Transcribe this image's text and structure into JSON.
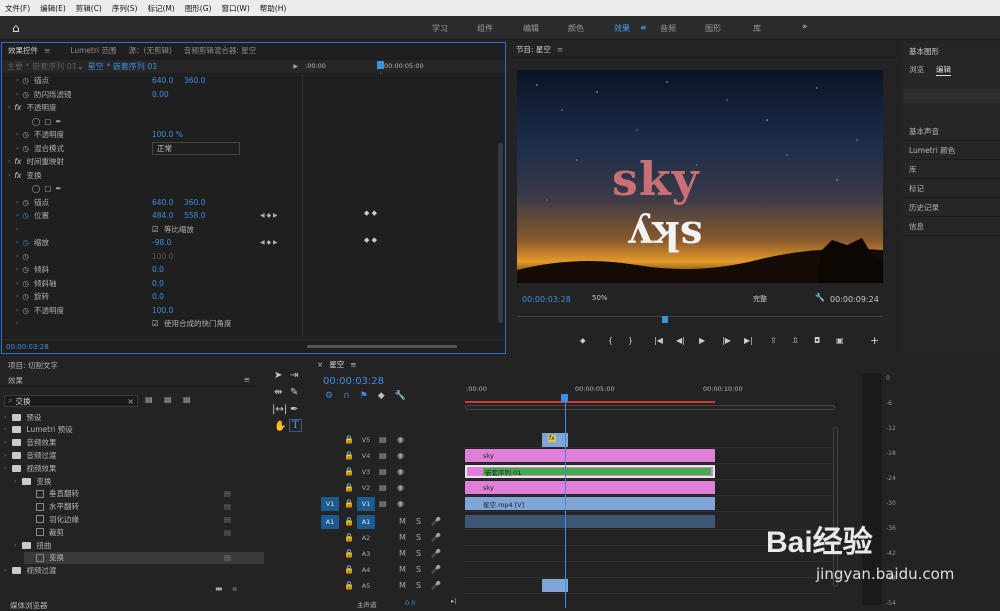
{
  "menu": [
    "文件(F)",
    "编辑(E)",
    "剪辑(C)",
    "序列(S)",
    "标记(M)",
    "图形(G)",
    "窗口(W)",
    "帮助(H)"
  ],
  "workspaces": {
    "items": [
      "学习",
      "组件",
      "编辑",
      "颜色",
      "效果",
      "音频",
      "图形",
      "库"
    ],
    "active": "效果",
    "more": "»"
  },
  "fx_panel": {
    "tabs": [
      "效果控件",
      "Lumetri 范围",
      "源：(无剪辑)",
      "音频剪辑混合器: 星空"
    ],
    "source_label": "主要 * 嵌套序列 01",
    "sequence_label": "星空 * 嵌套序列 01",
    "ruler_times": [
      ":00:00",
      "00:00:05:00"
    ],
    "rows": [
      {
        "label": "锚点",
        "v1": "640.0",
        "v2": "360.0",
        "indent": 2
      },
      {
        "label": "防闪烁滤镜",
        "v1": "0.00",
        "v2": "",
        "indent": 2
      },
      {
        "label": "不透明度",
        "v1": "",
        "v2": "",
        "indent": 1,
        "fx": true
      },
      {
        "label": "",
        "v1": "",
        "v2": "",
        "indent": 2,
        "shapes": true
      },
      {
        "label": "不透明度",
        "v1": "100.0 %",
        "v2": "",
        "indent": 2
      },
      {
        "label": "混合模式",
        "v1": "正常",
        "v2": "",
        "indent": 2,
        "dropdown": true
      },
      {
        "label": "时间重映射",
        "v1": "",
        "v2": "",
        "indent": 1,
        "fx": true
      },
      {
        "label": "变换",
        "v1": "",
        "v2": "",
        "indent": 1,
        "fx": true
      },
      {
        "label": "",
        "v1": "",
        "v2": "",
        "indent": 2,
        "shapes": true
      },
      {
        "label": "锚点",
        "v1": "640.0",
        "v2": "360.0",
        "indent": 2
      },
      {
        "label": "位置",
        "v1": "484.0",
        "v2": "558.0",
        "indent": 2,
        "kf": true
      },
      {
        "label": "等比缩放",
        "v1": "",
        "v2": "",
        "indent": 2,
        "check": true
      },
      {
        "label": "缩放",
        "v1": "-98.0",
        "v2": "",
        "indent": 2,
        "kf": true
      },
      {
        "label": "",
        "v1": "100.0",
        "v2": "",
        "indent": 2,
        "dim": true
      },
      {
        "label": "倾斜",
        "v1": "0.0",
        "v2": "",
        "indent": 2
      },
      {
        "label": "倾斜轴",
        "v1": "0.0",
        "v2": "",
        "indent": 2
      },
      {
        "label": "旋转",
        "v1": "0.0",
        "v2": "",
        "indent": 2
      },
      {
        "label": "不透明度",
        "v1": "100.0",
        "v2": "",
        "indent": 2
      },
      {
        "label": "使用合成的快门角度",
        "v1": "",
        "v2": "",
        "indent": 2,
        "check": true
      }
    ],
    "timecode": "00:00:03:28"
  },
  "program": {
    "title": "节目: 星空",
    "overlay_text": "sky",
    "timecode": "00:00:03:28",
    "zoom": "50%",
    "quality": "完整",
    "duration": "00:00:09:24"
  },
  "basic_panel": {
    "title": "基本图形",
    "tabs": [
      "浏览",
      "编辑"
    ],
    "items": [
      "基本声音",
      "Lumetri 颜色",
      "库",
      "标记",
      "历史记录",
      "信息"
    ]
  },
  "project": {
    "title": "项目: 切割文字",
    "effects_title": "效果",
    "search_value": "交换",
    "tree": [
      {
        "label": "预设",
        "level": 0,
        "type": "folder"
      },
      {
        "label": "Lumetri 预设",
        "level": 0,
        "type": "folder"
      },
      {
        "label": "音频效果",
        "level": 0,
        "type": "folder"
      },
      {
        "label": "音频过渡",
        "level": 0,
        "type": "folder"
      },
      {
        "label": "视频效果",
        "level": 0,
        "type": "folder"
      },
      {
        "label": "变换",
        "level": 1,
        "type": "folder"
      },
      {
        "label": "垂直翻转",
        "level": 2,
        "type": "fx"
      },
      {
        "label": "水平翻转",
        "level": 2,
        "type": "fx"
      },
      {
        "label": "羽化边缘",
        "level": 2,
        "type": "fx"
      },
      {
        "label": "裁剪",
        "level": 2,
        "type": "fx"
      },
      {
        "label": "扭曲",
        "level": 1,
        "type": "folder"
      },
      {
        "label": "变换",
        "level": 2,
        "type": "fx",
        "selected": true
      },
      {
        "label": "视频过渡",
        "level": 0,
        "type": "folder"
      }
    ],
    "footer": "媒体浏览器"
  },
  "timeline": {
    "title": "星空",
    "timecode": "00:00:03:28",
    "ruler": [
      ":00:00",
      "00:00:05:00",
      "00:00:10:00"
    ],
    "tracks": [
      {
        "name": "V5",
        "src": ""
      },
      {
        "name": "V4",
        "src": ""
      },
      {
        "name": "V3",
        "src": ""
      },
      {
        "name": "V2",
        "src": ""
      },
      {
        "name": "V1",
        "src": "V1"
      },
      {
        "name": "A1",
        "src": "A1"
      },
      {
        "name": "A2",
        "src": ""
      },
      {
        "name": "A3",
        "src": ""
      },
      {
        "name": "A4",
        "src": ""
      },
      {
        "name": "A5",
        "src": ""
      }
    ],
    "master_label": "主声道",
    "master_value": "0.0",
    "clips": {
      "v4": "sky",
      "v3": "嵌套序列 01",
      "v2": "sky",
      "v1": "星空.mp4 [V]",
      "v5": "fx"
    },
    "colors": {
      "pink": "#e07fd9",
      "green": "#3fae4a",
      "blue": "#7fa6d6",
      "dark": "#3c5673"
    }
  },
  "meters": {
    "scale": [
      "0",
      "-6",
      "-12",
      "-18",
      "-24",
      "-30",
      "-36",
      "-42",
      "-48",
      "-54"
    ]
  },
  "watermark": {
    "brand": "Bai经验",
    "url": "jingyan.baidu.com"
  }
}
